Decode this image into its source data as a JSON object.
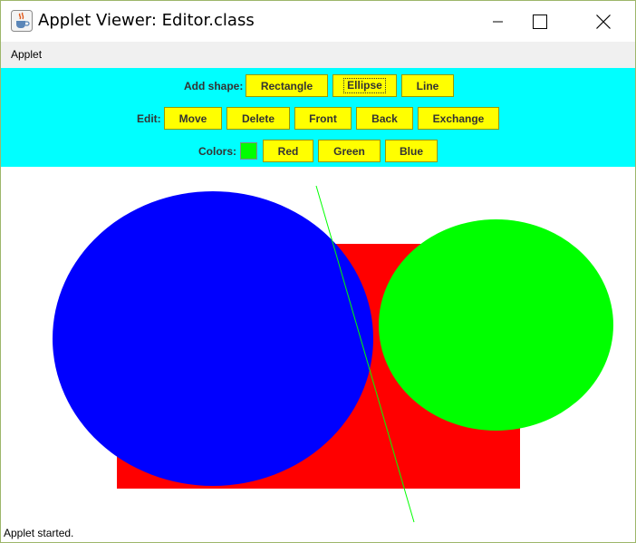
{
  "window": {
    "title": "Applet Viewer: Editor.class"
  },
  "menu": {
    "items": [
      "Applet"
    ]
  },
  "toolbar": {
    "add_shape_label": "Add shape:",
    "add_shape_buttons": [
      "Rectangle",
      "Ellipse",
      "Line"
    ],
    "edit_label": "Edit:",
    "edit_buttons": [
      "Move",
      "Delete",
      "Front",
      "Back",
      "Exchange"
    ],
    "colors_label": "Colors:",
    "current_color": "#00ff00",
    "color_buttons": [
      "Red",
      "Green",
      "Blue"
    ],
    "focused_button": "Ellipse",
    "background_color": "#00ffff",
    "button_color": "#ffff00"
  },
  "canvas": {
    "shapes": [
      {
        "type": "rectangle",
        "color": "#ff0000"
      },
      {
        "type": "ellipse",
        "color": "#0000ff"
      },
      {
        "type": "ellipse",
        "color": "#00ff00"
      },
      {
        "type": "line",
        "color": "#00ff00"
      }
    ]
  },
  "status": {
    "text": "Applet started."
  },
  "icons": {
    "app": "java-cup-icon",
    "minimize": "minimize-icon",
    "maximize": "maximize-icon",
    "close": "close-icon"
  }
}
